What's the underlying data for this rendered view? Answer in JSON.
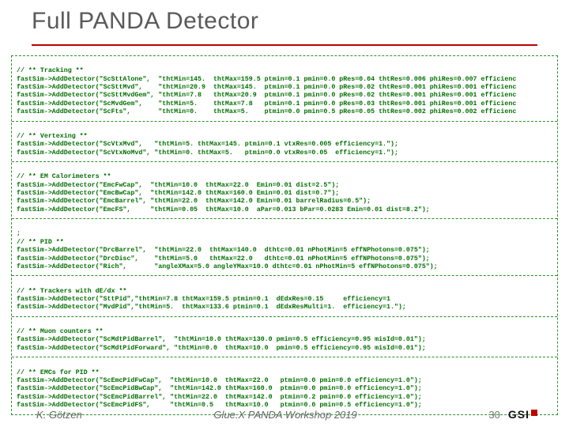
{
  "slide": {
    "title": "Full PANDA Detector"
  },
  "code": {
    "sec1_comment": "// ** Tracking **",
    "s1l1": "fastSim->AddDetector(\"ScSttAlone\",  \"thtMin=145.  thtMax=159.5 ptmin=0.1 pmin=0.0 pRes=0.04 thtRes=0.006 phiRes=0.007 efficienc",
    "s1l2": "fastSim->AddDetector(\"ScSttMvd\",    \"thtMin=20.9  thtMax=145.  ptmin=0.1 pmin=0.0 pRes=0.02 thtRes=0.001 phiRes=0.001 efficienc",
    "s1l3": "fastSim->AddDetector(\"ScSttMvdGem\", \"thtMin=7.8   thtMax=20.9  ptmin=0.1 pmin=0.0 pRes=0.02 thtRes=0.001 phiRes=0.001 efficienc",
    "s1l4": "fastSim->AddDetector(\"ScMvdGem\",    \"thtMin=5.    thtMax=7.8   ptmin=0.1 pmin=0.0 pRes=0.03 thtRes=0.001 phiRes=0.001 efficienc",
    "s1l5": "fastSim->AddDetector(\"ScFts\",       \"thtMin=0.    thtMax=5.    ptmin=0.0 pmin=0.5 pRes=0.05 thtRes=0.002 phiRes=0.002 efficienc",
    "sec2_comment": "// ** Vertexing **",
    "s2l1": "fastSim->AddDetector(\"ScVtxMvd\",   \"thtMin=5. thtMax=145. ptmin=0.1 vtxRes=0.005 efficiency=1.\");",
    "s2l2": "fastSim->AddDetector(\"ScVtxNoMvd\", \"thtMin=0. thtMax=5.   ptmin=0.0 vtxRes=0.05  efficiency=1.\");",
    "sec3_comment": "// ** EM Calorimeters **",
    "s3l1": "fastSim->AddDetector(\"EmcFwCap\",  \"thtMin=10.0  thtMax=22.0  Emin=0.01 dist=2.5\");",
    "s3l2": "fastSim->AddDetector(\"EmcBwCap\",  \"thtMin=142.0 thtMax=160.0 Emin=0.01 dist=0.7\");",
    "s3l3": "fastSim->AddDetector(\"EmcBarrel\", \"thtMin=22.0  thtMax=142.0 Emin=0.01 barrelRadius=0.5\");",
    "s3l4": "fastSim->AddDetector(\"EmcFS\",     \"thtMin=0.05  thtMax=10.0  aPar=0.013 bPar=0.0283 Emin=0.01 dist=8.2\");",
    "sec4_pre": ";",
    "sec4_comment": "// ** PID **",
    "s4l1": "fastSim->AddDetector(\"DrcBarrel\",  \"thtMin=22.0  thtMax=140.0  dthtc=0.01 nPhotMin=5 effNPhotons=0.075\");",
    "s4l2": "fastSim->AddDetector(\"DrcDisc\",    \"thtMin=5.0   thtMax=22.0   dthtc=0.01 nPhotMin=5 effNPhotons=0.075\");",
    "s4l3": "fastSim->AddDetector(\"Rich\",       \"angleXMax=5.0 angleYMax=10.0 dthtc=0.01 nPhotMin=5 effNPhotons=0.075\");",
    "sec5_comment": "// ** Trackers with dE/dx **",
    "s5l1": "fastSim->AddDetector(\"SttPid\",\"thtMin=7.8 thtMax=159.5 ptmin=0.1  dEdxRes=0.15     efficiency=1",
    "s5l2": "fastSim->AddDetector(\"MvdPid\",\"thtMin=5.  thtMax=133.6 ptmin=0.1  dEdxResMulti=1.  efficiency=1.\");",
    "sec6_comment": "// ** Muon counters **",
    "s6l1": "fastSim->AddDetector(\"ScMdtPidBarrel\",  \"thtMin=10.0 thtMax=130.0 pmin=0.5 efficiency=0.95 misId=0.01\");",
    "s6l2": "fastSim->AddDetector(\"ScMdtPidForward\", \"thtMin=0.0  thtMax=10.0  pmin=0.5 efficiency=0.95 misId=0.01\");",
    "sec7_comment": "// ** EMCs for PID **",
    "s7l1": "fastSim->AddDetector(\"ScEmcPidFwCap\",  \"thtMin=10.0  thtMax=22.0   ptmin=0.0 pmin=0.0 efficiency=1.0\");",
    "s7l2": "fastSim->AddDetector(\"ScEmcPidBwCap\",  \"thtMin=142.0 thtMax=160.0  ptmin=0.0 pmin=0.0 efficiency=1.0\");",
    "s7l3": "fastSim->AddDetector(\"ScEmcPidBarrel\", \"thtMin=22.0  thtMax=142.0  ptmin=0.2 pmin=0.0 efficiency=1.0\");",
    "s7l4": "fastSim->AddDetector(\"ScEmcPidFS\",     \"thtMin=0.5   thtMax=10.0   ptmin=0.0 pmin=0.5 efficiency=1.0\");"
  },
  "footer": {
    "author": "K. Götzen",
    "event": "Glue.X PANDA Workshop 2019",
    "page": "30",
    "brand": "GSI"
  }
}
